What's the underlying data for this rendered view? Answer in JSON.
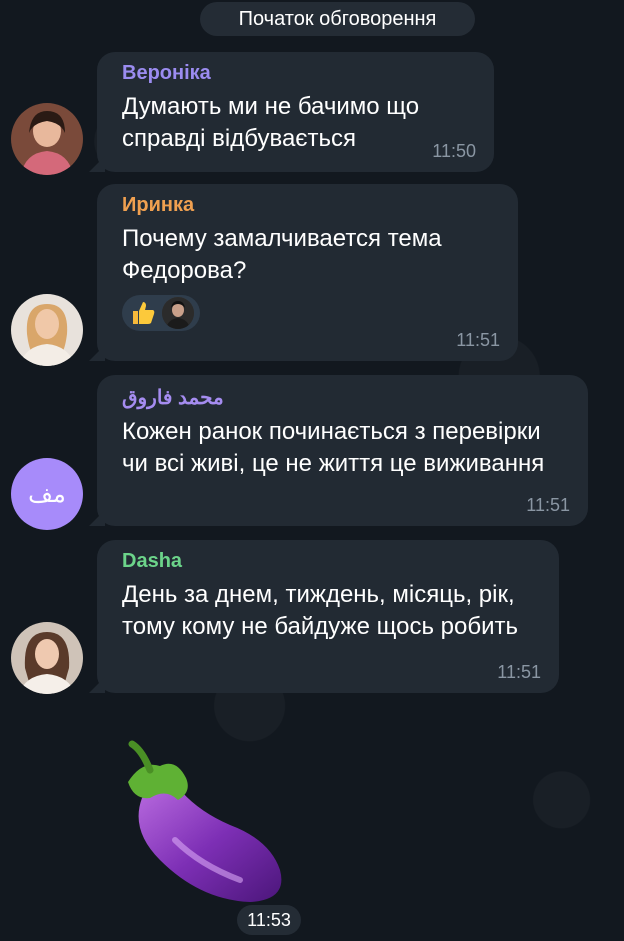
{
  "service_message": "Початок обговорення",
  "messages": [
    {
      "sender": "Вероніка",
      "sender_color": "#9b8cf0",
      "text": "Думають ми не бачимо що справді відбувається",
      "time": "11:50"
    },
    {
      "sender": "Иринка",
      "sender_color": "#f0a050",
      "text": "Почему замалчивается тема Федорова?",
      "time": "11:51",
      "reactions": [
        "thumbs-up-emoji"
      ]
    },
    {
      "sender": "محمد فاروق",
      "sender_color": "#a58cf0",
      "avatar_initials": "مف",
      "avatar_color": "#a78bfa",
      "text": "Кожен ранок починається з перевірки чи всі живі, це не життя це виживання",
      "time": "11:51"
    },
    {
      "sender": "Dasha",
      "sender_color": "#6cd48a",
      "text": "День за днем, тиждень, місяць, рік, тому кому не байдуже щось робить",
      "time": "11:51"
    }
  ],
  "sticker": {
    "icon": "eggplant-sticker",
    "time": "11:53"
  },
  "colors": {
    "bubble": "#222a33",
    "background": "#12181f",
    "time_text": "#8a96a3"
  }
}
